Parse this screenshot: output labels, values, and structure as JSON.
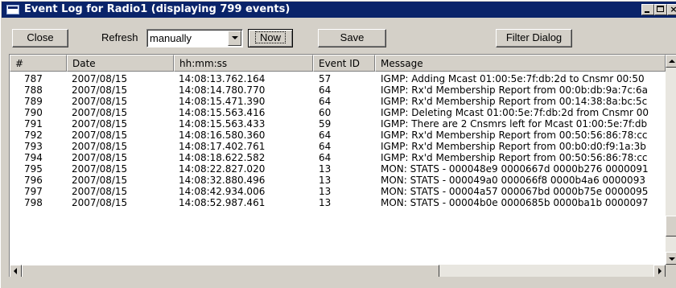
{
  "window": {
    "title": "Event Log for Radio1 (displaying 799 events)"
  },
  "toolbar": {
    "close_label": "Close",
    "refresh_label": "Refresh",
    "refresh_selected": "manually",
    "now_label": "Now",
    "save_label": "Save",
    "filter_label": "Filter Dialog"
  },
  "table": {
    "columns": [
      "#",
      "Date",
      "hh:mm:ss",
      "Event ID",
      "Message"
    ],
    "rows": [
      [
        "787",
        "2007/08/15",
        "14:08:13.762.164",
        "57",
        "IGMP: Adding Mcast 01:00:5e:7f:db:2d to Cnsmr 00:50"
      ],
      [
        "788",
        "2007/08/15",
        "14:08:14.780.770",
        "64",
        "IGMP: Rx'd Membership Report from 00:0b:db:9a:7c:6a"
      ],
      [
        "789",
        "2007/08/15",
        "14:08:15.471.390",
        "64",
        "IGMP: Rx'd Membership Report from 00:14:38:8a:bc:5c"
      ],
      [
        "790",
        "2007/08/15",
        "14:08:15.563.416",
        "60",
        "IGMP: Deleting Mcast 01:00:5e:7f:db:2d from Cnsmr 00"
      ],
      [
        "791",
        "2007/08/15",
        "14:08:15.563.433",
        "59",
        "IGMP: There are 2 Cnsmrs left for Mcast 01:00:5e:7f:db"
      ],
      [
        "792",
        "2007/08/15",
        "14:08:16.580.360",
        "64",
        "IGMP: Rx'd Membership Report from 00:50:56:86:78:cc"
      ],
      [
        "793",
        "2007/08/15",
        "14:08:17.402.761",
        "64",
        "IGMP: Rx'd Membership Report from 00:b0:d0:f9:1a:3b"
      ],
      [
        "794",
        "2007/08/15",
        "14:08:18.622.582",
        "64",
        "IGMP: Rx'd Membership Report from 00:50:56:86:78:cc"
      ],
      [
        "795",
        "2007/08/15",
        "14:08:22.827.020",
        "13",
        "MON: STATS - 000048e9 0000667d 0000b276 0000091"
      ],
      [
        "796",
        "2007/08/15",
        "14:08:32.880.496",
        "13",
        "MON: STATS - 000049a0 000066f8 0000b4a6 0000093"
      ],
      [
        "797",
        "2007/08/15",
        "14:08:42.934.006",
        "13",
        "MON: STATS - 00004a57 000067bd 0000b75e 0000095"
      ],
      [
        "798",
        "2007/08/15",
        "14:08:52.987.461",
        "13",
        "MON: STATS - 00004b0e 0000685b 0000ba1b 0000097"
      ]
    ]
  },
  "icons": {
    "app": "window-icon",
    "minimize": "minimize-icon",
    "maximize": "maximize-icon",
    "close": "close-icon",
    "dropdown": "chevron-down-icon"
  },
  "colors": {
    "titlebar": "#0a246a",
    "face": "#d4d0c8",
    "list_bg": "#ffffff"
  }
}
